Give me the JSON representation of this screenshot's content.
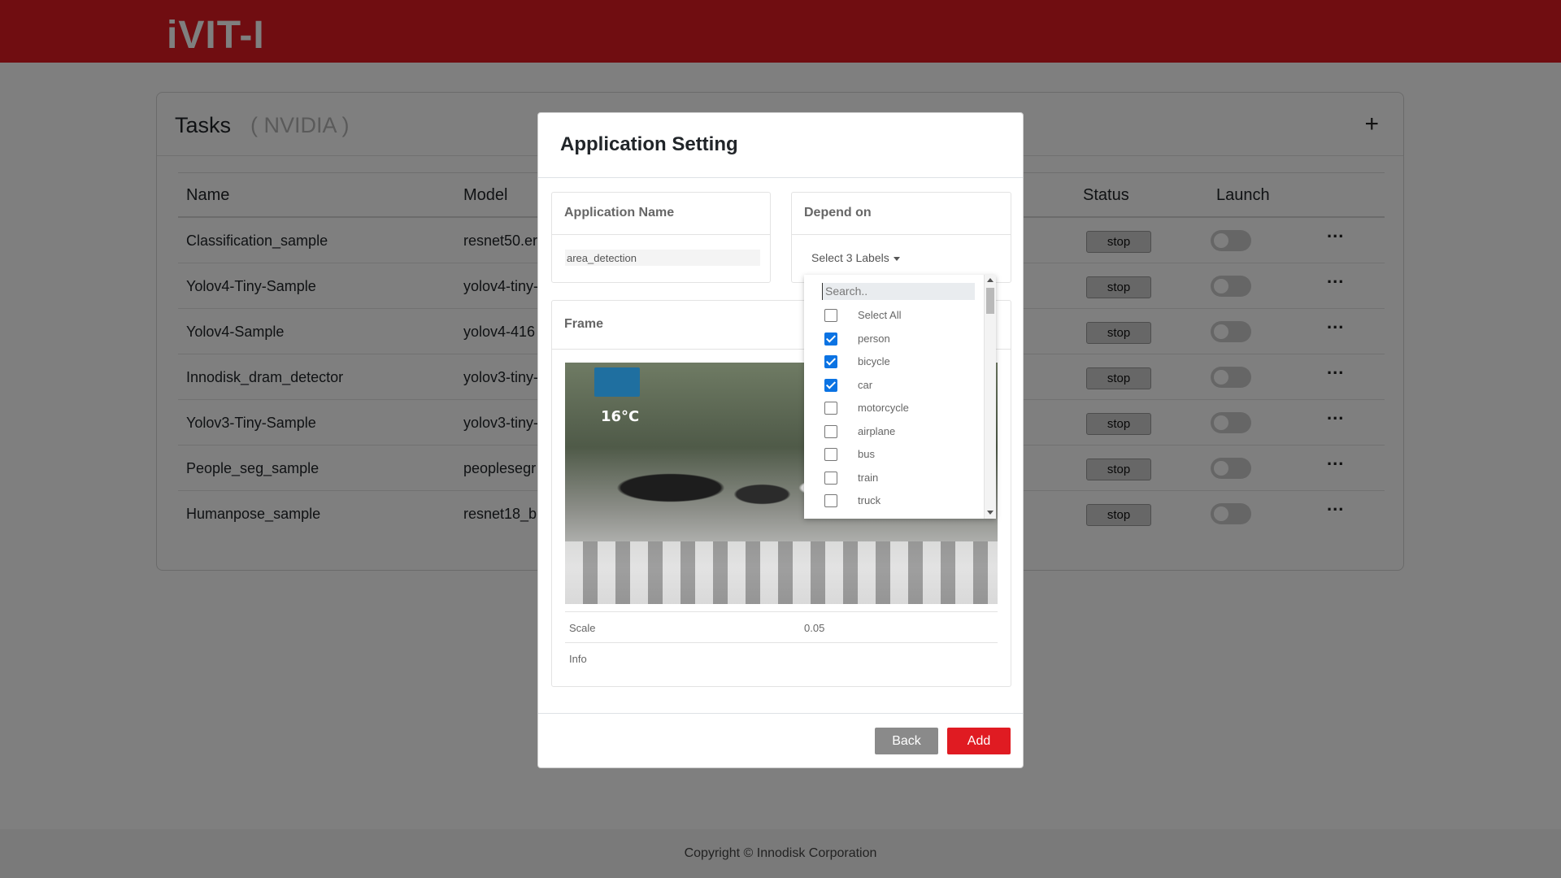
{
  "header": {
    "logo": "iVIT-I"
  },
  "tasks": {
    "title": "Tasks",
    "subtitle": "( NVIDIA )",
    "add_icon": "+",
    "columns": {
      "name": "Name",
      "model": "Model",
      "status": "Status",
      "launch": "Launch"
    },
    "rows": [
      {
        "name": "Classification_sample",
        "model": "resnet50.er",
        "status": "stop"
      },
      {
        "name": "Yolov4-Tiny-Sample",
        "model": "yolov4-tiny-",
        "status": "stop"
      },
      {
        "name": "Yolov4-Sample",
        "model": "yolov4-416",
        "status": "stop"
      },
      {
        "name": "Innodisk_dram_detector",
        "model": "yolov3-tiny-",
        "status": "stop"
      },
      {
        "name": "Yolov3-Tiny-Sample",
        "model": "yolov3-tiny-",
        "status": "stop"
      },
      {
        "name": "People_seg_sample",
        "model": "peoplesegr",
        "status": "stop"
      },
      {
        "name": "Humanpose_sample",
        "model": "resnet18_b",
        "status": "stop"
      }
    ],
    "more_icon": "..."
  },
  "footer": {
    "text": "Copyright © Innodisk Corporation"
  },
  "modal": {
    "title": "Application Setting",
    "app_name": {
      "label": "Application Name",
      "value": "area_detection"
    },
    "depend_on": {
      "label": "Depend on",
      "toggle_label": "Select 3 Labels"
    },
    "frame": {
      "label": "Frame",
      "image_text": "16°C",
      "scale_label": "Scale",
      "scale_value": "0.05",
      "info_label": "Info"
    },
    "buttons": {
      "back": "Back",
      "add": "Add"
    }
  },
  "dropdown": {
    "search_placeholder": "Search..",
    "items": [
      {
        "label": "Select All",
        "checked": false
      },
      {
        "label": "person",
        "checked": true
      },
      {
        "label": "bicycle",
        "checked": true
      },
      {
        "label": "car",
        "checked": true
      },
      {
        "label": "motorcycle",
        "checked": false
      },
      {
        "label": "airplane",
        "checked": false
      },
      {
        "label": "bus",
        "checked": false
      },
      {
        "label": "train",
        "checked": false
      },
      {
        "label": "truck",
        "checked": false
      }
    ]
  },
  "colors": {
    "brand": "#e01b22",
    "checkbox_checked": "#0b73e3",
    "back_button": "#8a8a8a"
  },
  "icons": {
    "add": "plus-icon",
    "more": "more-horizontal-icon",
    "caret": "caret-down-icon"
  }
}
